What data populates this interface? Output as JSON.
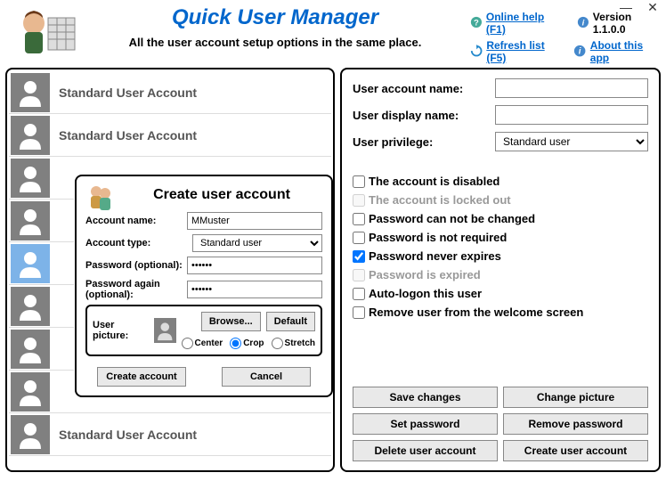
{
  "window": {
    "minimize": "—",
    "close": "✕"
  },
  "header": {
    "title": "Quick User Manager",
    "subtitle": "All the user account setup options in the same place.",
    "links": {
      "help_label": "Online help (F1)",
      "version_label": "Version 1.1.0.0",
      "refresh_label": "Refresh list (F5)",
      "about_label": "About this app"
    }
  },
  "userlist": {
    "items": [
      {
        "label": "Standard User Account",
        "selected": false
      },
      {
        "label": "Standard User Account",
        "selected": false
      },
      {
        "label": "",
        "selected": false
      },
      {
        "label": "",
        "selected": false
      },
      {
        "label": "",
        "selected": true
      },
      {
        "label": "",
        "selected": false
      },
      {
        "label": "",
        "selected": false
      },
      {
        "label": "",
        "selected": false
      },
      {
        "label": "Standard User Account",
        "selected": false
      }
    ]
  },
  "detail": {
    "labels": {
      "account_name": "User account name:",
      "display_name": "User display name:",
      "privilege": "User privilege:"
    },
    "values": {
      "account_name": "",
      "display_name": "",
      "privilege": "Standard user"
    },
    "checkboxes": {
      "disabled": {
        "label": "The account is disabled",
        "checked": false,
        "enabled": true
      },
      "locked": {
        "label": "The account is locked out",
        "checked": false,
        "enabled": false
      },
      "nochange": {
        "label": "Password can not be changed",
        "checked": false,
        "enabled": true
      },
      "notreq": {
        "label": "Password is not required",
        "checked": false,
        "enabled": true
      },
      "neverexp": {
        "label": "Password never expires",
        "checked": true,
        "enabled": true
      },
      "expired": {
        "label": "Password is expired",
        "checked": false,
        "enabled": false
      },
      "autologon": {
        "label": "Auto-logon this user",
        "checked": false,
        "enabled": true
      },
      "remwelcome": {
        "label": "Remove user from the welcome screen",
        "checked": false,
        "enabled": true
      }
    },
    "buttons": {
      "save": "Save changes",
      "changepic": "Change picture",
      "setpwd": "Set password",
      "rempwd": "Remove password",
      "delete": "Delete user account",
      "create": "Create user account"
    }
  },
  "dialog": {
    "title": "Create user account",
    "labels": {
      "account_name": "Account name:",
      "account_type": "Account type:",
      "password": "Password (optional):",
      "password2": "Password again (optional):",
      "user_picture": "User picture:"
    },
    "values": {
      "account_name": "MMuster",
      "account_type": "Standard user",
      "password": "••••••",
      "password2": "••••••"
    },
    "buttons": {
      "browse": "Browse...",
      "default": "Default",
      "create": "Create account",
      "cancel": "Cancel"
    },
    "radios": {
      "center": "Center",
      "crop": "Crop",
      "stretch": "Stretch",
      "selected": "crop"
    }
  }
}
